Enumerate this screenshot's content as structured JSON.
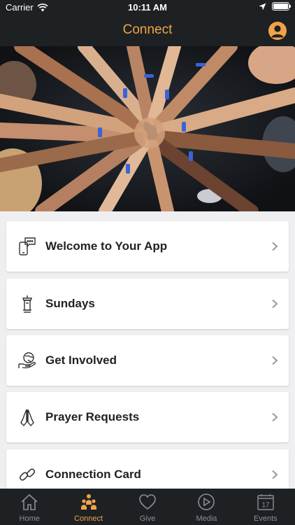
{
  "status_bar": {
    "carrier": "Carrier",
    "time": "10:11 AM"
  },
  "header": {
    "title": "Connect"
  },
  "hero": {
    "image": "hands-together-photo"
  },
  "list": {
    "items": [
      {
        "label": "Welcome to Your App",
        "icon": "phone-chat-icon"
      },
      {
        "label": "Sundays",
        "icon": "pulpit-icon"
      },
      {
        "label": "Get Involved",
        "icon": "hand-globe-icon"
      },
      {
        "label": "Prayer Requests",
        "icon": "praying-hands-icon"
      },
      {
        "label": "Connection Card",
        "icon": "link-icon"
      }
    ]
  },
  "tab_bar": {
    "active": "Connect",
    "tabs": [
      {
        "label": "Home",
        "icon": "home-icon"
      },
      {
        "label": "Connect",
        "icon": "people-icon"
      },
      {
        "label": "Give",
        "icon": "heart-icon"
      },
      {
        "label": "Media",
        "icon": "play-icon"
      },
      {
        "label": "Events",
        "icon": "calendar-icon",
        "calendar_day": "17"
      }
    ]
  },
  "colors": {
    "accent": "#f0a447",
    "bar_bg": "#1e2124",
    "page_bg": "#efeff1",
    "tab_inactive": "#8a8d92"
  }
}
